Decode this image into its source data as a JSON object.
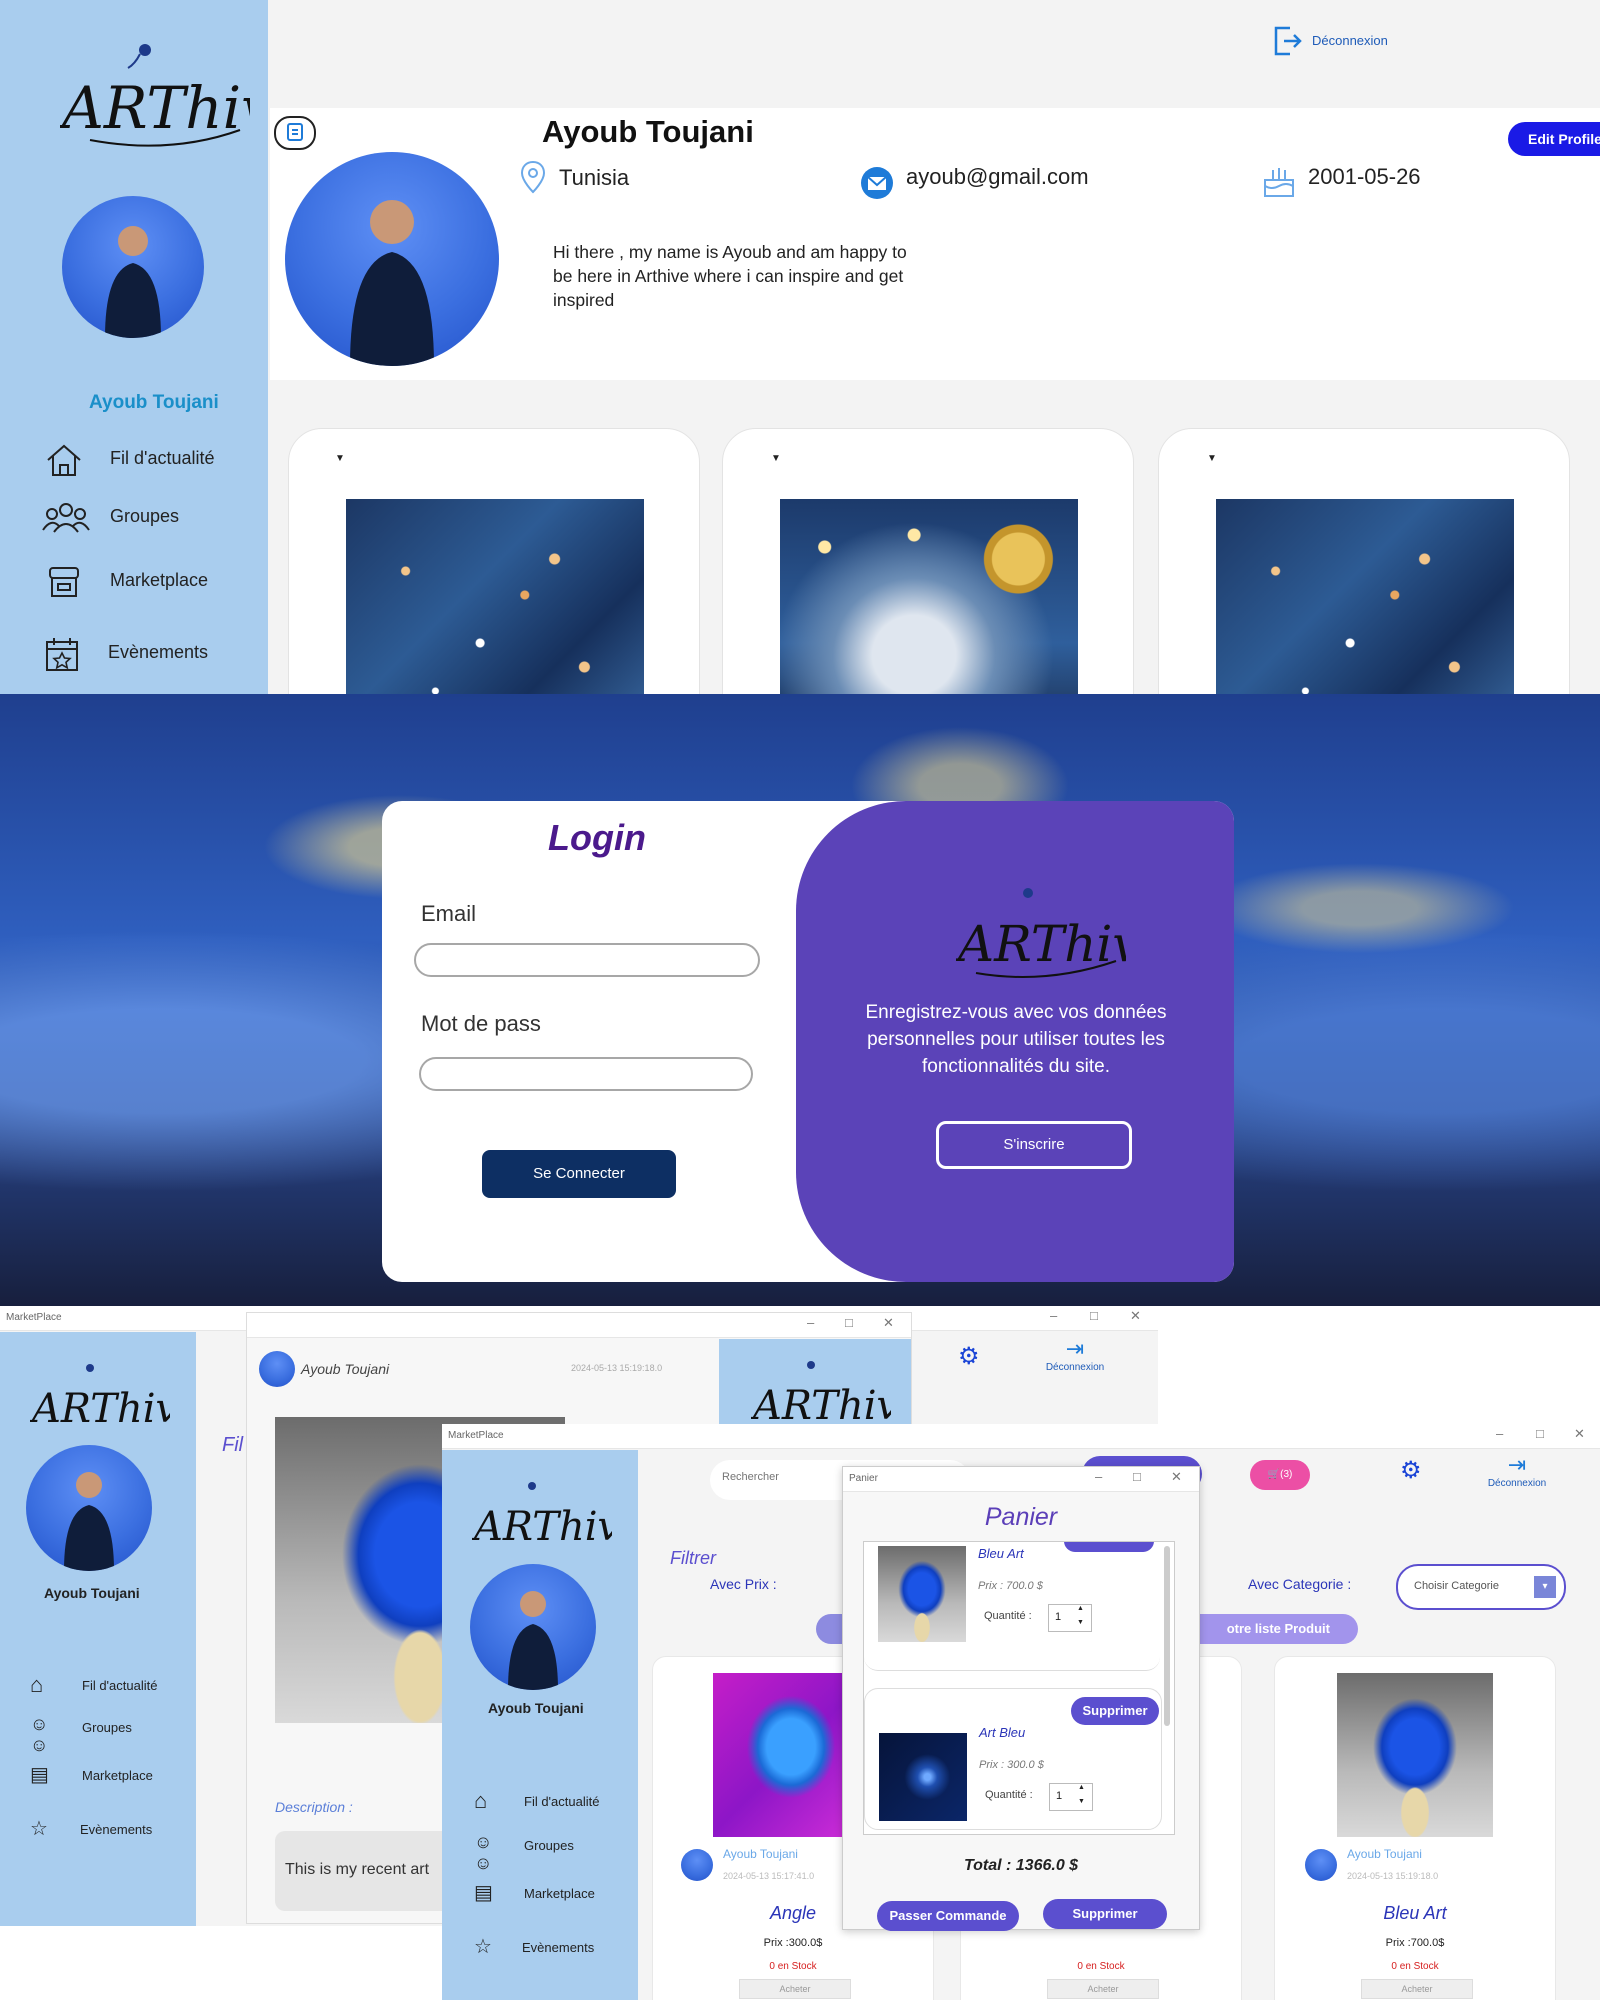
{
  "brand": {
    "logo_text": "ARThive"
  },
  "profile": {
    "logout_label": "Déconnexion",
    "name": "Ayoub Toujani",
    "edit_label": "Edit Profile",
    "location": "Tunisia",
    "email": "ayoub@gmail.com",
    "birthdate": "2001-05-26",
    "bio": "Hi there , my name is Ayoub and am happy to be here in Arthive where i can inspire and get inspired",
    "sidebar_name": "Ayoub Toujani",
    "nav": [
      "Fil d'actualité",
      "Groupes",
      "Marketplace",
      "Evènements"
    ]
  },
  "login": {
    "title": "Login",
    "email_label": "Email",
    "password_label": "Mot de pass",
    "email_value": "",
    "password_value": "",
    "submit_label": "Se Connecter",
    "signup_text": "Enregistrez-vous avec vos données personnelles pour utiliser toutes les fonctionnalités du site.",
    "signup_label": "S'inscrire"
  },
  "marketplace": {
    "window_title": "MarketPlace",
    "sidebar_name": "Ayoub Toujani",
    "nav": [
      "Fil d'actualité",
      "Groupes",
      "Marketplace",
      "Evènements"
    ],
    "logout_label": "Déconnexion",
    "search_placeholder": "Rechercher",
    "cart_count": "(3)",
    "filter_label": "Filtrer",
    "filter_partial": "Fil",
    "price_label": "Avec Prix :",
    "category_label": "Avec Categorie :",
    "category_select": "Choisir Categorie",
    "list_button_partial": "otre liste Produit",
    "post": {
      "author": "Ayoub Toujani",
      "date": "2024-05-13 15:19:18.0",
      "description_label": "Description :",
      "description": "This is my recent art"
    },
    "products": [
      {
        "author": "Ayoub Toujani",
        "date": "2024-05-13 15:17:41.0",
        "name": "Angle",
        "price": "Prix :300.0$",
        "stock": "0 en Stock",
        "buy": "Acheter"
      },
      {
        "stock": "0 en Stock",
        "buy": "Acheter"
      },
      {
        "author": "Ayoub Toujani",
        "date": "2024-05-13 15:19:18.0",
        "name": "Bleu Art",
        "price": "Prix :700.0$",
        "stock": "0 en Stock",
        "buy": "Acheter"
      }
    ]
  },
  "cart": {
    "window_title": "Panier",
    "title": "Panier",
    "items": [
      {
        "name": "Bleu Art",
        "price": "Prix : 700.0 $",
        "qty_label": "Quantité :",
        "qty": "1"
      },
      {
        "name": "Art Bleu",
        "price": "Prix : 300.0 $",
        "qty_label": "Quantité :",
        "qty": "1",
        "remove": "Supprimer"
      }
    ],
    "total": "Total : 1366.0 $",
    "order_label": "Passer Commande",
    "delete_label": "Supprimer"
  }
}
